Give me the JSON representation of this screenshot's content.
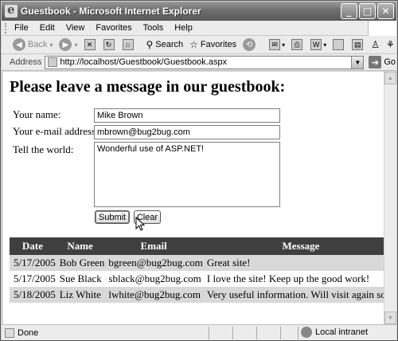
{
  "window": {
    "title": "Guestbook - Microsoft Internet Explorer"
  },
  "menu": [
    "File",
    "Edit",
    "View",
    "Favorites",
    "Tools",
    "Help"
  ],
  "toolbar": {
    "back": "Back",
    "search": "Search",
    "favorites": "Favorites"
  },
  "address": {
    "label": "Address",
    "url": "http://localhost/Guestbook/Guestbook.aspx",
    "go": "Go"
  },
  "page": {
    "heading": "Please leave a message in our guestbook:",
    "form": {
      "name_label": "Your name:",
      "name_value": "Mike Brown",
      "email_label": "Your e-mail address:",
      "email_value": "mbrown@bug2bug.com",
      "message_label": "Tell the world:",
      "message_value": "Wonderful use of ASP.NET!",
      "submit": "Submit",
      "clear": "Clear"
    },
    "table": {
      "headers": [
        "Date",
        "Name",
        "Email",
        "Message"
      ],
      "rows": [
        [
          "5/17/2005",
          "Bob Green",
          "bgreen@bug2bug.com",
          "Great site!"
        ],
        [
          "5/17/2005",
          "Sue Black",
          "sblack@bug2bug.com",
          "I love the site! Keep up the good work!"
        ],
        [
          "5/18/2005",
          "Liz White",
          "lwhite@bug2bug.com",
          "Very useful information. Will visit again soon."
        ]
      ]
    }
  },
  "status": {
    "text": "Done",
    "zone": "Local intranet"
  }
}
